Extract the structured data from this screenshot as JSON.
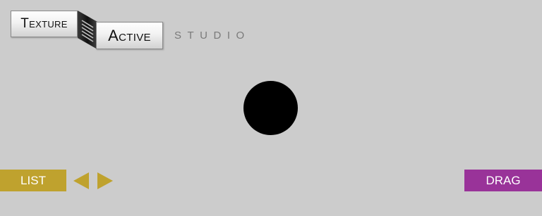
{
  "logo": {
    "word1": "Texture",
    "word2": "Active",
    "tagline": "STUDIO"
  },
  "controls": {
    "list_label": "LIST",
    "prev_icon": "triangle-left-icon",
    "next_icon": "triangle-right-icon",
    "drag_label": "DRAG"
  },
  "colors": {
    "background": "#cccccc",
    "list_button": "#bfa22e",
    "drag_button": "#993399",
    "arrows": "#bfa22e",
    "center_dot": "#000000"
  }
}
